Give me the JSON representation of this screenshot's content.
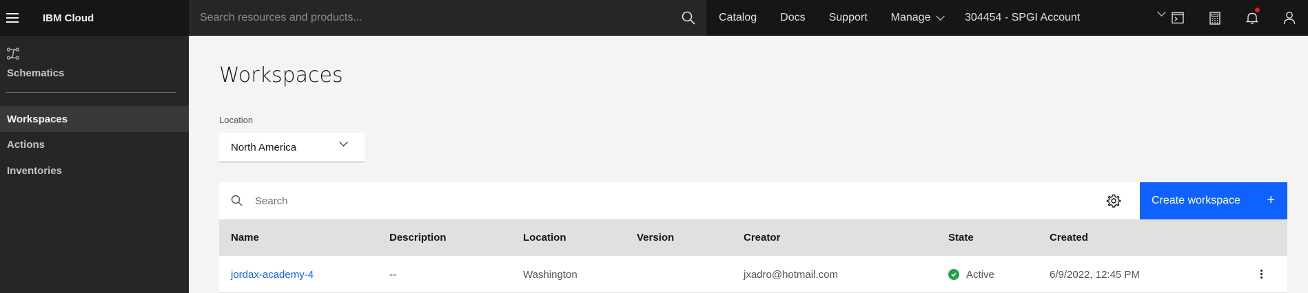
{
  "topbar": {
    "brand": "IBM Cloud",
    "search_placeholder": "Search resources and products...",
    "nav": [
      "Catalog",
      "Docs",
      "Support",
      "Manage"
    ],
    "account": "304454 - SPGI Account"
  },
  "sidebar": {
    "title": "Schematics",
    "items": [
      {
        "label": "Workspaces",
        "active": true
      },
      {
        "label": "Actions",
        "active": false
      },
      {
        "label": "Inventories",
        "active": false
      }
    ]
  },
  "main": {
    "title": "Workspaces",
    "location_label": "Location",
    "location_value": "North America",
    "search_placeholder": "Search",
    "create_button": "Create workspace",
    "columns": [
      "Name",
      "Description",
      "Location",
      "Version",
      "Creator",
      "State",
      "Created"
    ],
    "rows": [
      {
        "name": "jordax-academy-4",
        "description": "--",
        "location": "Washington",
        "version": "",
        "creator": "jxadro@hotmail.com",
        "state": "Active",
        "created": "6/9/2022, 12:45 PM"
      }
    ]
  },
  "colors": {
    "primary": "#0f62fe",
    "active_state": "#24a148",
    "notification": "#da1e28"
  }
}
